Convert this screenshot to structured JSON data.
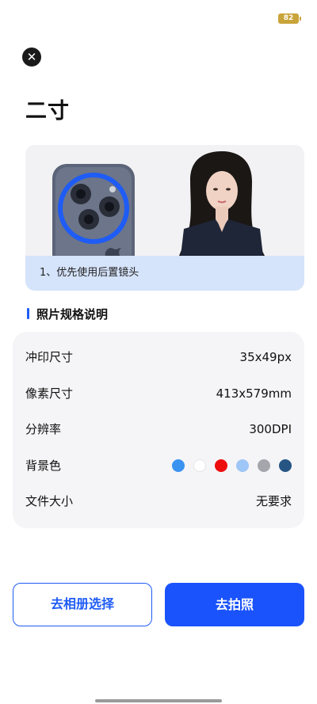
{
  "status_bar": {
    "battery": "82"
  },
  "header": {
    "close_icon": "close-icon",
    "title": "二寸"
  },
  "guide": {
    "caption": "1、优先使用后置镜头",
    "illustrations": [
      "phone-rear-camera",
      "portrait-photo"
    ],
    "highlight_color": "#1f5cf5"
  },
  "specs": {
    "title": "照片规格说明",
    "rows": [
      {
        "label": "冲印尺寸",
        "value": "35x49px"
      },
      {
        "label": "像素尺寸",
        "value": "413x579mm"
      },
      {
        "label": "分辨率",
        "value": "300DPI"
      },
      {
        "label": "背景色",
        "colors": [
          "#3a93f0",
          "#ffffff",
          "#ee0d0d",
          "#9ec6f7",
          "#a5a6ab",
          "#265584"
        ]
      },
      {
        "label": "文件大小",
        "value": "无要求"
      }
    ]
  },
  "actions": {
    "album_label": "去相册选择",
    "shoot_label": "去拍照"
  },
  "colors": {
    "accent": "#1a53fb",
    "caption_bg": "#d5e3fb",
    "card_bg": "#f5f5f7"
  }
}
